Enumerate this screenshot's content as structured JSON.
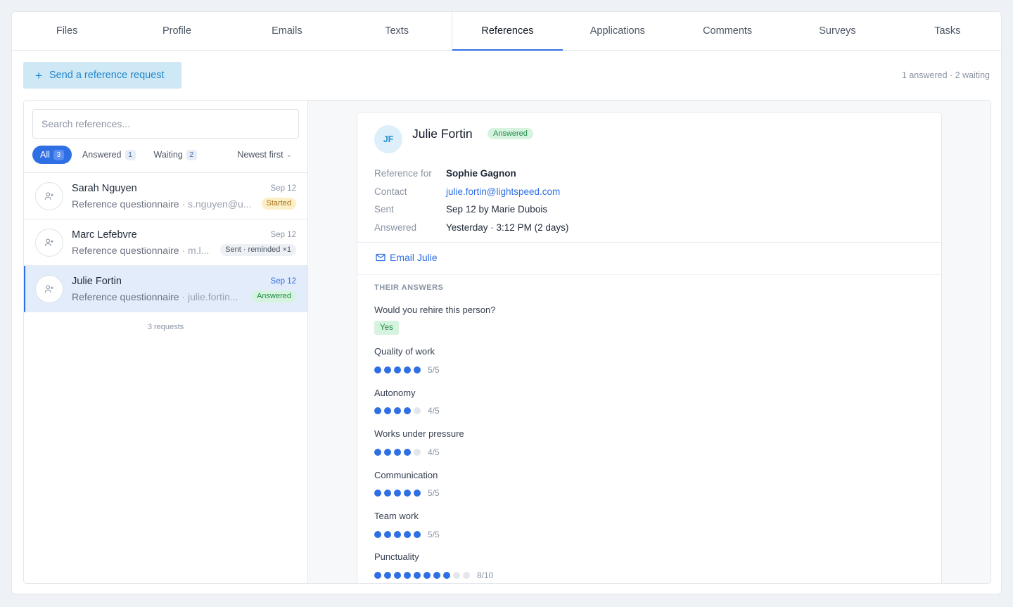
{
  "tabs": [
    {
      "label": "Files"
    },
    {
      "label": "Profile"
    },
    {
      "label": "Emails"
    },
    {
      "label": "Texts"
    },
    {
      "label": "References",
      "active": true
    },
    {
      "label": "Applications"
    },
    {
      "label": "Comments"
    },
    {
      "label": "Surveys"
    },
    {
      "label": "Tasks"
    }
  ],
  "toolbar": {
    "send_label": "Send a reference request",
    "summary": "1 answered · 2 waiting"
  },
  "search": {
    "placeholder": "Search references..."
  },
  "filters": {
    "all": {
      "label": "All",
      "count": "3"
    },
    "answered": {
      "label": "Answered",
      "count": "1"
    },
    "waiting": {
      "label": "Waiting",
      "count": "2"
    },
    "sort": "Newest first"
  },
  "list": {
    "items": [
      {
        "name": "Sarah Nguyen",
        "type": "Reference questionnaire",
        "email": "s.nguyen@u...",
        "date": "Sep 12",
        "status": "Started"
      },
      {
        "name": "Marc Lefebvre",
        "type": "Reference questionnaire",
        "email": "m.l...",
        "date": "Sep 12",
        "status": "Sent · reminded ×1"
      },
      {
        "name": "Julie Fortin",
        "type": "Reference questionnaire",
        "email": "julie.fortin...",
        "date": "Sep 12",
        "status": "Answered"
      }
    ],
    "footer": "3 requests"
  },
  "detail": {
    "initials": "JF",
    "name": "Julie Fortin",
    "status": "Answered",
    "meta": {
      "reference_for_label": "Reference for",
      "reference_for": "Sophie Gagnon",
      "contact_label": "Contact",
      "contact": "julie.fortin@lightspeed.com",
      "sent_label": "Sent",
      "sent": "Sep 12 by Marie Dubois",
      "answered_label": "Answered",
      "answered": "Yesterday · 3:12 PM (2 days)"
    },
    "email_label": "Email Julie",
    "answers_title": "THEIR ANSWERS",
    "rehire_question": "Would you rehire this person?",
    "rehire_answer": "Yes",
    "ratings": [
      {
        "question": "Quality of work",
        "value": 5,
        "max": 5,
        "label": "5/5"
      },
      {
        "question": "Autonomy",
        "value": 4,
        "max": 5,
        "label": "4/5"
      },
      {
        "question": "Works under pressure",
        "value": 4,
        "max": 5,
        "label": "4/5"
      },
      {
        "question": "Communication",
        "value": 5,
        "max": 5,
        "label": "5/5"
      },
      {
        "question": "Team work",
        "value": 5,
        "max": 5,
        "label": "5/5"
      },
      {
        "question": "Punctuality",
        "value": 8,
        "max": 10,
        "label": "8/10"
      }
    ]
  },
  "colors": {
    "accent": "#2f6fe4",
    "send_bg": "#cfe8f6",
    "answered_bg": "#d6f3df",
    "started_bg": "#fcefc7"
  }
}
